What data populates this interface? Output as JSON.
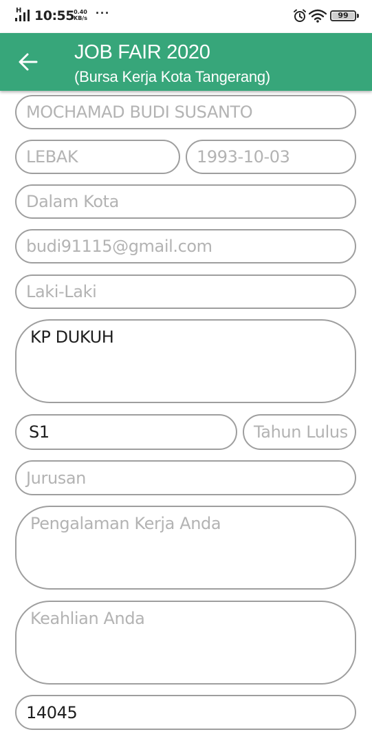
{
  "status_bar": {
    "network_type": "H",
    "time": "10:55",
    "speed_value": "0.40",
    "speed_unit": "KB/s",
    "more": "···",
    "battery": "99",
    "icons": [
      "signal-icon",
      "alarm-icon",
      "wifi-icon",
      "battery-icon"
    ]
  },
  "app_bar": {
    "title": "JOB FAIR 2020",
    "subtitle": "(Bursa Kerja Kota Tangerang)",
    "back_icon": "arrow-left-icon",
    "color": "#37a67a"
  },
  "form": {
    "full_name": "MOCHAMAD BUDI SUSANTO",
    "birth_place": "LEBAK",
    "birth_date": "1993-10-03",
    "domicile": "Dalam Kota",
    "email": "budi91115@gmail.com",
    "gender": "Laki-Laki",
    "address": "KP DUKUH",
    "education": "S1",
    "graduation_year_placeholder": "Tahun Lulus",
    "major_placeholder": "Jurusan",
    "work_experience_placeholder": "Pengalaman Kerja Anda",
    "skills_placeholder": "Keahlian Anda",
    "postal_code": "14045"
  }
}
